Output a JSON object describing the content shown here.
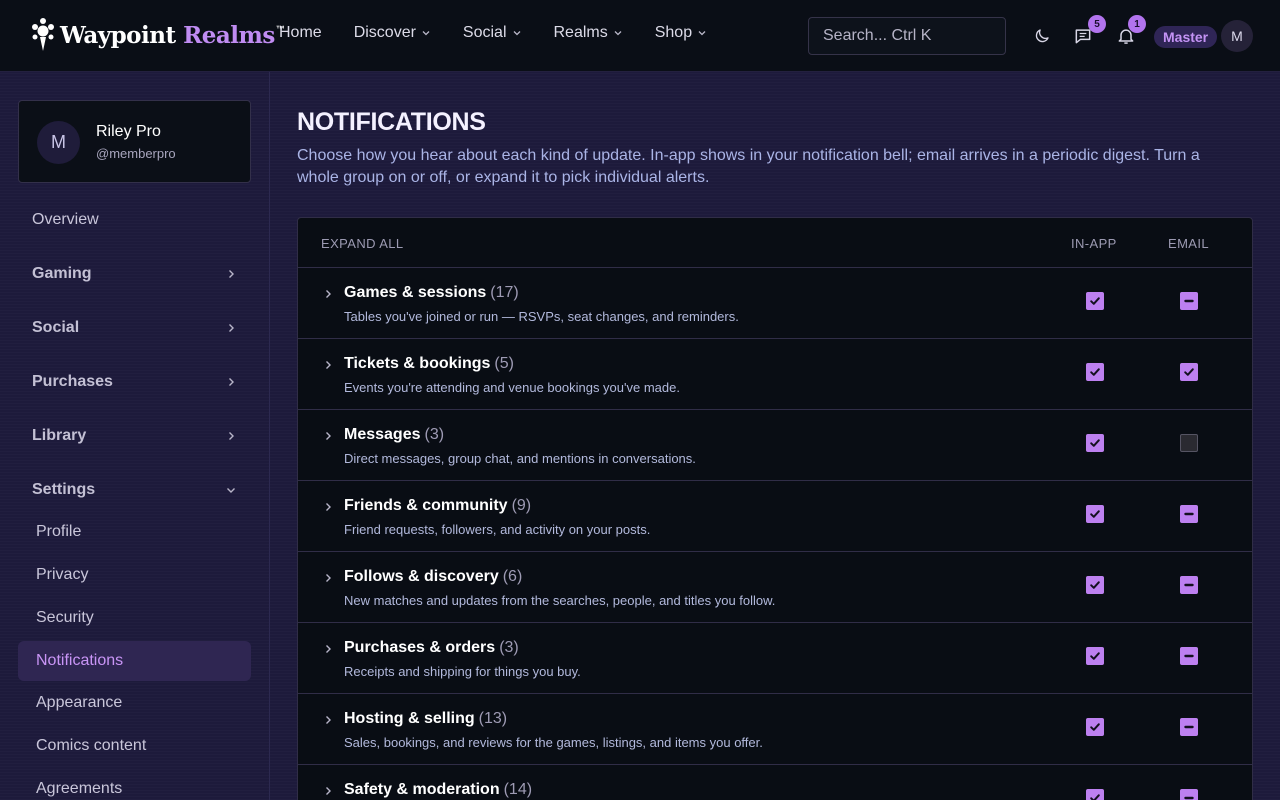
{
  "brand": {
    "name_main": "Waypoint",
    "name_accent": "Realms",
    "trademark": "™"
  },
  "nav": [
    {
      "label": "Home",
      "has_menu": false
    },
    {
      "label": "Discover",
      "has_menu": true
    },
    {
      "label": "Social",
      "has_menu": true
    },
    {
      "label": "Realms",
      "has_menu": true
    },
    {
      "label": "Shop",
      "has_menu": true
    }
  ],
  "search": {
    "placeholder": "Search...  Ctrl K"
  },
  "header": {
    "messages_count": "5",
    "notifications_count": "1",
    "tier_label": "Master",
    "avatar_initial": "M"
  },
  "sidebar": {
    "profile": {
      "initial": "M",
      "name": "Riley Pro",
      "handle": "@memberpro"
    },
    "items": [
      {
        "label": "Overview"
      },
      {
        "label": "Gaming"
      },
      {
        "label": "Social"
      },
      {
        "label": "Purchases"
      },
      {
        "label": "Library"
      },
      {
        "label": "Settings"
      }
    ],
    "settings_items": [
      {
        "label": "Profile"
      },
      {
        "label": "Privacy"
      },
      {
        "label": "Security"
      },
      {
        "label": "Notifications"
      },
      {
        "label": "Appearance"
      },
      {
        "label": "Comics content"
      },
      {
        "label": "Agreements"
      }
    ]
  },
  "main": {
    "title": "NOTIFICATIONS",
    "description": "Choose how you hear about each kind of update. In-app shows in your notification bell; email arrives in a periodic digest. Turn a whole group on or off, or expand it to pick individual alerts.",
    "table": {
      "expand_all": "EXPAND ALL",
      "col_inapp": "IN-APP",
      "col_email": "EMAIL",
      "rows": [
        {
          "title": "Games & sessions",
          "count": "(17)",
          "desc": "Tables you've joined or run — RSVPs, seat changes, and reminders.",
          "inapp": "checked",
          "email": "mixed"
        },
        {
          "title": "Tickets & bookings",
          "count": "(5)",
          "desc": "Events you're attending and venue bookings you've made.",
          "inapp": "checked",
          "email": "checked"
        },
        {
          "title": "Messages",
          "count": "(3)",
          "desc": "Direct messages, group chat, and mentions in conversations.",
          "inapp": "checked",
          "email": "unchecked"
        },
        {
          "title": "Friends & community",
          "count": "(9)",
          "desc": "Friend requests, followers, and activity on your posts.",
          "inapp": "checked",
          "email": "mixed"
        },
        {
          "title": "Follows & discovery",
          "count": "(6)",
          "desc": "New matches and updates from the searches, people, and titles you follow.",
          "inapp": "checked",
          "email": "mixed"
        },
        {
          "title": "Purchases & orders",
          "count": "(3)",
          "desc": "Receipts and shipping for things you buy.",
          "inapp": "checked",
          "email": "mixed"
        },
        {
          "title": "Hosting & selling",
          "count": "(13)",
          "desc": "Sales, bookings, and reviews for the games, listings, and items you offer.",
          "inapp": "checked",
          "email": "mixed"
        },
        {
          "title": "Safety & moderation",
          "count": "(14)",
          "desc": "",
          "inapp": "checked",
          "email": "mixed"
        }
      ]
    }
  }
}
